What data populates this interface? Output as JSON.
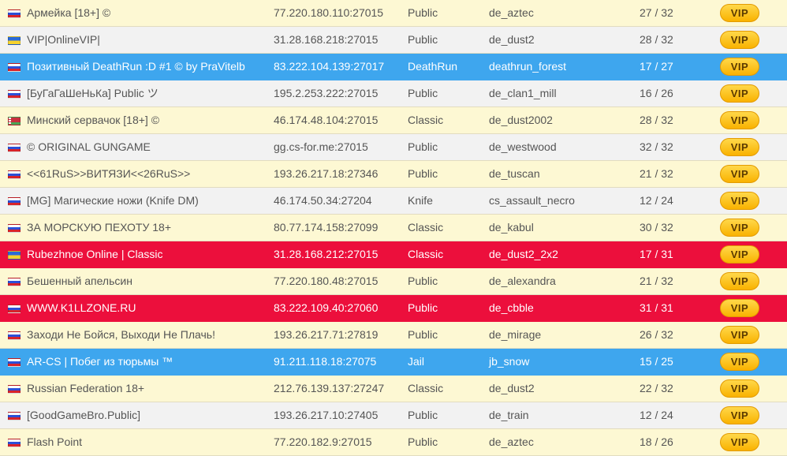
{
  "servers": [
    {
      "flag": "ru",
      "name": "Армейка [18+] ©",
      "address": "77.220.180.110:27015",
      "mode": "Public",
      "map": "de_aztec",
      "players": "27 / 32",
      "style": "alt-a"
    },
    {
      "flag": "ua",
      "name": "VIP|OnlineVIP|",
      "address": "31.28.168.218:27015",
      "mode": "Public",
      "map": "de_dust2",
      "players": "28 / 32",
      "style": "alt-b"
    },
    {
      "flag": "ru",
      "name": "Позитивный DeathRun :D #1 © by PraVitelb",
      "address": "83.222.104.139:27017",
      "mode": "DeathRun",
      "map": "deathrun_forest",
      "players": "17 / 27",
      "style": "hl-blue"
    },
    {
      "flag": "ru",
      "name": "[БуГаГаШеНьКа] Public ツ",
      "address": "195.2.253.222:27015",
      "mode": "Public",
      "map": "de_clan1_mill",
      "players": "16 / 26",
      "style": "alt-b"
    },
    {
      "flag": "by",
      "name": "Минский сервачок [18+] ©",
      "address": "46.174.48.104:27015",
      "mode": "Classic",
      "map": "de_dust2002",
      "players": "28 / 32",
      "style": "alt-a"
    },
    {
      "flag": "ru",
      "name": "© ORIGINAL GUNGAME",
      "address": "gg.cs-for.me:27015",
      "mode": "Public",
      "map": "de_westwood",
      "players": "32 / 32",
      "style": "alt-b"
    },
    {
      "flag": "ru",
      "name": "<<61RuS>>ВИТЯЗИ<<26RuS>>",
      "address": "193.26.217.18:27346",
      "mode": "Public",
      "map": "de_tuscan",
      "players": "21 / 32",
      "style": "alt-a"
    },
    {
      "flag": "ru",
      "name": "[MG] Магические ножи (Knife DM)",
      "address": "46.174.50.34:27204",
      "mode": "Knife",
      "map": "cs_assault_necro",
      "players": "12 / 24",
      "style": "alt-b"
    },
    {
      "flag": "ru",
      "name": "ЗА МОРСКУЮ ПЕХОТУ 18+",
      "address": "80.77.174.158:27099",
      "mode": "Classic",
      "map": "de_kabul",
      "players": "30 / 32",
      "style": "alt-a"
    },
    {
      "flag": "ua",
      "name": "Rubezhnoe Online | Classic",
      "address": "31.28.168.212:27015",
      "mode": "Classic",
      "map": "de_dust2_2x2",
      "players": "17 / 31",
      "style": "hl-red"
    },
    {
      "flag": "ru",
      "name": "Бешенный апельсин",
      "address": "77.220.180.48:27015",
      "mode": "Public",
      "map": "de_alexandra",
      "players": "21 / 32",
      "style": "alt-a"
    },
    {
      "flag": "ru",
      "name": "WWW.K1LLZONE.RU",
      "address": "83.222.109.40:27060",
      "mode": "Public",
      "map": "de_cbble",
      "players": "31 / 31",
      "style": "hl-red"
    },
    {
      "flag": "ru",
      "name": "Заходи Не Бойся, Выходи Не Плачь!",
      "address": "193.26.217.71:27819",
      "mode": "Public",
      "map": "de_mirage",
      "players": "26 / 32",
      "style": "alt-a"
    },
    {
      "flag": "ru",
      "name": "AR-CS | Побег из тюрьмы ™",
      "address": "91.211.118.18:27075",
      "mode": "Jail",
      "map": "jb_snow",
      "players": "15 / 25",
      "style": "hl-blue"
    },
    {
      "flag": "ru",
      "name": "Russian Federation 18+",
      "address": "212.76.139.137:27247",
      "mode": "Classic",
      "map": "de_dust2",
      "players": "22 / 32",
      "style": "alt-a"
    },
    {
      "flag": "ru",
      "name": "[GoodGameBro.Public]",
      "address": "193.26.217.10:27405",
      "mode": "Public",
      "map": "de_train",
      "players": "12 / 24",
      "style": "alt-b"
    },
    {
      "flag": "ru",
      "name": "Flash Point",
      "address": "77.220.182.9:27015",
      "mode": "Public",
      "map": "de_aztec",
      "players": "18 / 26",
      "style": "alt-a"
    }
  ],
  "vip_label": "VIP"
}
